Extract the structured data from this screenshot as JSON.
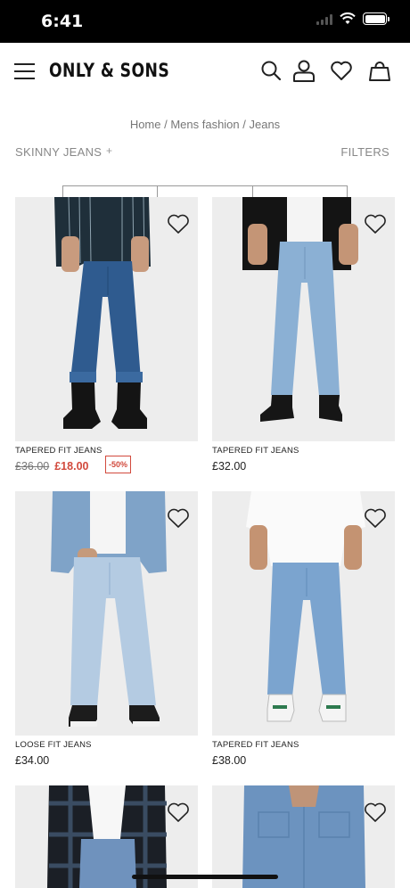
{
  "status": {
    "time": "6:41"
  },
  "header": {
    "logo": "ONLY & SONS",
    "icons": [
      "hamburger-menu-icon",
      "search-icon",
      "account-icon",
      "heart-icon",
      "bag-icon"
    ]
  },
  "breadcrumb": "Home / Mens fashion / Jeans",
  "category": {
    "name": "SKINNY JEANS",
    "plus": "+",
    "filters_label": "FILTERS"
  },
  "colors": {
    "sale": "#d24a3d",
    "denim_dark": "#2f5b8f",
    "denim_light": "#8bb0d4",
    "image_bg": "#ededed"
  },
  "products": [
    {
      "name": "TAPERED FIT JEANS",
      "old_price": "£36.00",
      "price": "£18.00",
      "discount": "-50%"
    },
    {
      "name": "TAPERED FIT JEANS",
      "price": "£32.00"
    },
    {
      "name": "LOOSE FIT JEANS",
      "price": "£34.00"
    },
    {
      "name": "TAPERED FIT JEANS",
      "price": "£38.00"
    },
    {
      "name": "",
      "price": ""
    },
    {
      "name": "",
      "price": ""
    }
  ]
}
